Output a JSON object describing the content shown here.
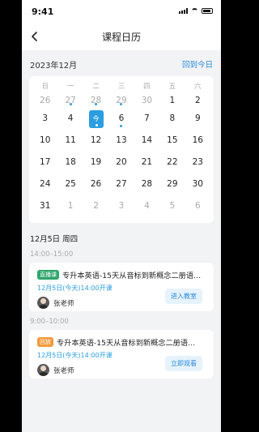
{
  "status": {
    "time": "9:41"
  },
  "nav": {
    "title": "课程日历"
  },
  "calendar": {
    "month_label": "2023年12月",
    "today_label": "回到今日",
    "weekdays": [
      "日",
      "一",
      "二",
      "三",
      "四",
      "五",
      "六"
    ],
    "days": [
      {
        "d": "26",
        "muted": true,
        "dot": false
      },
      {
        "d": "27",
        "muted": true,
        "dot": true
      },
      {
        "d": "28",
        "muted": true,
        "dot": true
      },
      {
        "d": "29",
        "muted": true,
        "dot": true
      },
      {
        "d": "30",
        "muted": true,
        "dot": false
      },
      {
        "d": "1",
        "muted": false,
        "dot": false
      },
      {
        "d": "2",
        "muted": false,
        "dot": false
      },
      {
        "d": "3",
        "muted": false,
        "dot": false
      },
      {
        "d": "4",
        "muted": false,
        "dot": false
      },
      {
        "d": "今",
        "muted": false,
        "dot": false,
        "selected": true
      },
      {
        "d": "6",
        "muted": false,
        "dot": true
      },
      {
        "d": "7",
        "muted": false,
        "dot": false
      },
      {
        "d": "8",
        "muted": false,
        "dot": false
      },
      {
        "d": "9",
        "muted": false,
        "dot": false
      },
      {
        "d": "10",
        "muted": false,
        "dot": false
      },
      {
        "d": "11",
        "muted": false,
        "dot": false
      },
      {
        "d": "12",
        "muted": false,
        "dot": false
      },
      {
        "d": "13",
        "muted": false,
        "dot": false
      },
      {
        "d": "14",
        "muted": false,
        "dot": false
      },
      {
        "d": "15",
        "muted": false,
        "dot": false
      },
      {
        "d": "16",
        "muted": false,
        "dot": false
      },
      {
        "d": "17",
        "muted": false,
        "dot": false
      },
      {
        "d": "18",
        "muted": false,
        "dot": false
      },
      {
        "d": "19",
        "muted": false,
        "dot": false
      },
      {
        "d": "20",
        "muted": false,
        "dot": false
      },
      {
        "d": "21",
        "muted": false,
        "dot": false
      },
      {
        "d": "22",
        "muted": false,
        "dot": false
      },
      {
        "d": "23",
        "muted": false,
        "dot": false
      },
      {
        "d": "24",
        "muted": false,
        "dot": false
      },
      {
        "d": "25",
        "muted": false,
        "dot": false
      },
      {
        "d": "26",
        "muted": false,
        "dot": false
      },
      {
        "d": "27",
        "muted": false,
        "dot": false
      },
      {
        "d": "28",
        "muted": false,
        "dot": false
      },
      {
        "d": "29",
        "muted": false,
        "dot": false
      },
      {
        "d": "30",
        "muted": false,
        "dot": false
      },
      {
        "d": "31",
        "muted": false,
        "dot": false
      },
      {
        "d": "1",
        "muted": true,
        "dot": false
      },
      {
        "d": "2",
        "muted": true,
        "dot": false
      },
      {
        "d": "3",
        "muted": true,
        "dot": false
      },
      {
        "d": "4",
        "muted": true,
        "dot": false
      },
      {
        "d": "5",
        "muted": true,
        "dot": false
      },
      {
        "d": "6",
        "muted": true,
        "dot": false
      }
    ]
  },
  "schedule": {
    "date_heading": "12月5日 周四",
    "sessions": [
      {
        "slot": "14:00–15:00",
        "tag": "直播课",
        "tag_type": "live",
        "title": "专升本英语-15天从音标到新概念二册语…",
        "time": "12月5日(今天)14:00开课",
        "teacher": "张老师",
        "action": "进入教室"
      },
      {
        "slot": "9:00–10:00",
        "tag": "回放",
        "tag_type": "replay",
        "title": "专升本英语-15天从音标到新概念二册语…",
        "time": "12月5日(今天)14:00开课",
        "teacher": "张老师",
        "action": "立即观看"
      }
    ]
  },
  "colors": {
    "accent": "#2b9ee0",
    "live": "#2ea56a",
    "replay": "#f29a3a"
  }
}
